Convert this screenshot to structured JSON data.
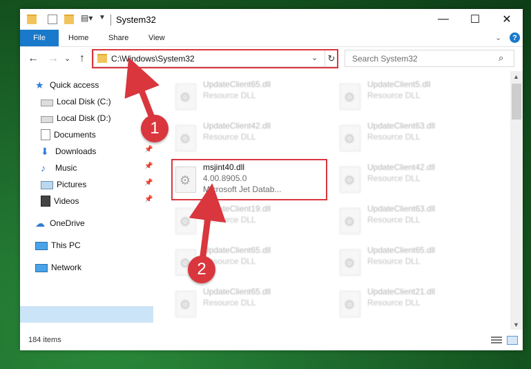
{
  "window": {
    "title": "System32",
    "controls": {
      "minimize": "—",
      "maximize": "☐",
      "close": "✕"
    }
  },
  "ribbon": {
    "tabs": [
      "File",
      "Home",
      "Share",
      "View"
    ],
    "expand_icon": "chevron-down-icon",
    "help": "?"
  },
  "navigation": {
    "back": "←",
    "forward": "→",
    "recent": "⌄",
    "up": "↑"
  },
  "address": {
    "path": "C:\\Windows\\System32",
    "dropdown": "⌄",
    "refresh": "↻"
  },
  "search": {
    "placeholder": "Search System32",
    "icon": "⌕"
  },
  "sidebar": {
    "items": [
      {
        "label": "Quick access",
        "icon": "star-icon",
        "pinned": false
      },
      {
        "label": "Local Disk (C:)",
        "icon": "drive-icon",
        "pinned": false
      },
      {
        "label": "Local Disk (D:)",
        "icon": "drive-icon",
        "pinned": false
      },
      {
        "label": "Documents",
        "icon": "documents-icon",
        "pinned": false
      },
      {
        "label": "Downloads",
        "icon": "download-icon",
        "pinned": true
      },
      {
        "label": "Music",
        "icon": "music-icon",
        "pinned": true
      },
      {
        "label": "Pictures",
        "icon": "pictures-icon",
        "pinned": true
      },
      {
        "label": "Videos",
        "icon": "videos-icon",
        "pinned": true
      },
      {
        "label": "OneDrive",
        "icon": "cloud-icon",
        "pinned": false
      },
      {
        "label": "This PC",
        "icon": "computer-icon",
        "pinned": false,
        "selected": true
      },
      {
        "label": "Network",
        "icon": "network-icon",
        "pinned": false
      }
    ]
  },
  "files": {
    "left_column": [
      {
        "name": "UpdateClient65.dll",
        "type": "Resource DLL"
      },
      {
        "name": "UpdateClient42.dll",
        "type": "Resource DLL"
      },
      {
        "name": "msjint40.dll",
        "version": "4.00.8905.0",
        "description": "Microsoft Jet Datab..."
      },
      {
        "name": "UpdateClient19.dll",
        "type": "Resource DLL"
      },
      {
        "name": "UpdateClient65.dll",
        "type": "Resource DLL"
      },
      {
        "name": "UpdateClient65.dll",
        "type": "Resource DLL"
      }
    ],
    "right_column": [
      {
        "name": "UpdateClient5.dll",
        "type": "Resource DLL"
      },
      {
        "name": "UpdateClient63.dll",
        "type": "Resource DLL"
      },
      {
        "name": "UpdateClient42.dll",
        "type": "Resource DLL"
      },
      {
        "name": "UpdateClient63.dll",
        "type": "Resource DLL"
      },
      {
        "name": "UpdateClient65.dll",
        "type": "Resource DLL"
      },
      {
        "name": "UpdateClient21.dll",
        "type": "Resource DLL"
      }
    ]
  },
  "status": {
    "item_count": "184 items"
  },
  "annotations": {
    "step1": "1",
    "step2": "2",
    "color": "#d9363e"
  }
}
